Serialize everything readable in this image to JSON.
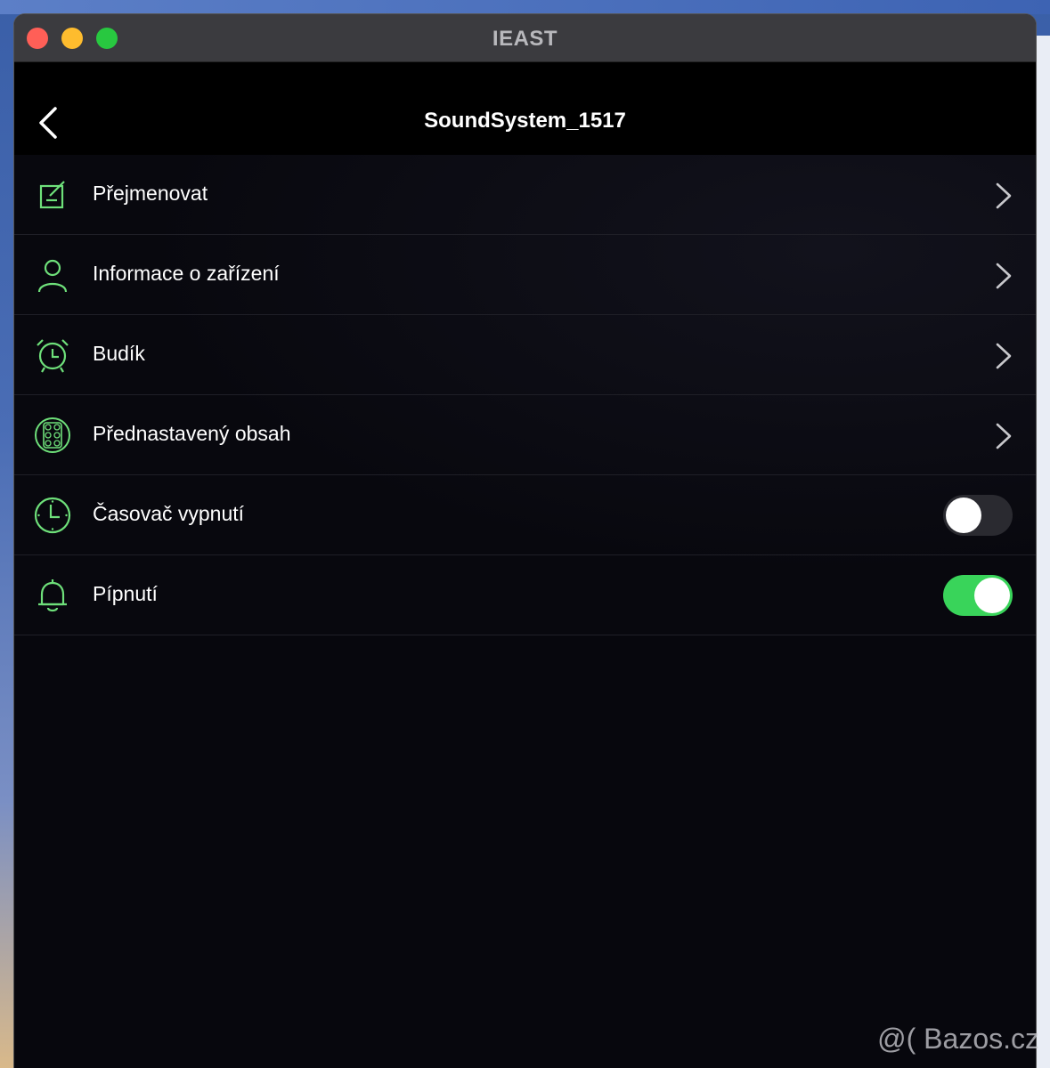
{
  "window": {
    "title": "IEAST"
  },
  "nav": {
    "title": "SoundSystem_1517"
  },
  "menu": [
    {
      "label": "Přejmenovat",
      "icon": "rename-icon"
    },
    {
      "label": "Informace o zařízení",
      "icon": "person-icon"
    },
    {
      "label": "Budík",
      "icon": "alarm-clock-icon"
    },
    {
      "label": "Přednastavený obsah",
      "icon": "preset-grid-icon"
    }
  ],
  "toggles": [
    {
      "label": "Časovač vypnutí",
      "icon": "clock-icon",
      "state": "off"
    },
    {
      "label": "Pípnutí",
      "icon": "bell-icon",
      "state": "on"
    }
  ],
  "watermark": "@( Bazos.cz",
  "colors": {
    "accent": "#39d45a",
    "icon_green": "#6ee07a"
  }
}
